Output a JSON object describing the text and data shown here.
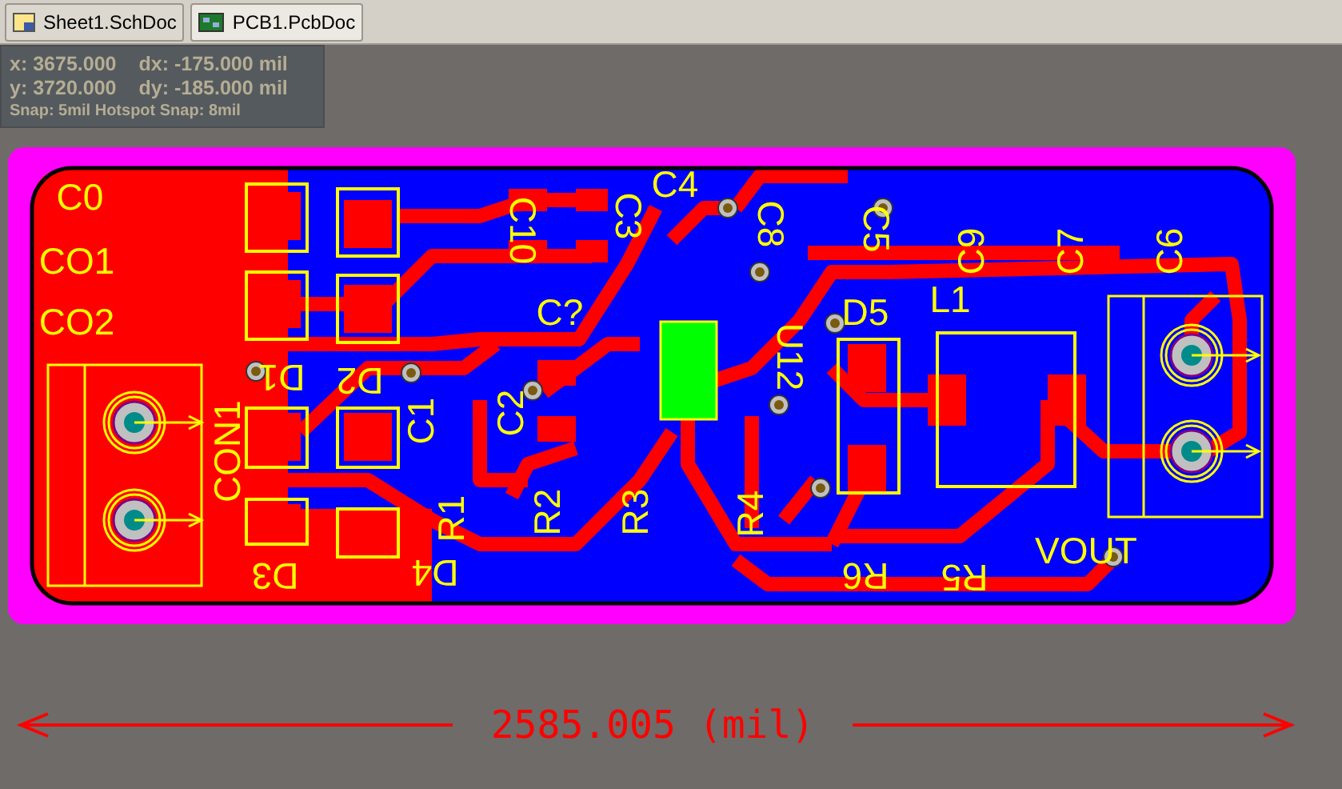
{
  "tabs": [
    {
      "label": "Sheet1.SchDoc",
      "kind": "schematic",
      "selected": false
    },
    {
      "label": "PCB1.PcbDoc",
      "kind": "pcb",
      "selected": true
    }
  ],
  "cursor_info": {
    "rows": [
      {
        "axis": "x:",
        "value": "3675.000",
        "delta_label": "dx:",
        "delta": "-175.000",
        "unit": "mil"
      },
      {
        "axis": "y:",
        "value": "3720.000",
        "delta_label": "dy:",
        "delta": "-185.000",
        "unit": "mil"
      }
    ],
    "snap": "Snap: 5mil Hotspot Snap: 8mil"
  },
  "designators": [
    "C0",
    "CO1",
    "CO2",
    "CON1",
    "D1",
    "D2",
    "C1",
    "C2",
    "C?",
    "C10",
    "C3",
    "C4",
    "C8",
    "C5",
    "C9",
    "C7",
    "C6",
    "U12",
    "D5",
    "L1",
    "R1",
    "R2",
    "R3",
    "R4",
    "D3",
    "D4",
    "R6",
    "R5",
    "VOUT"
  ],
  "dimension": {
    "text": "2585.005 (mil)"
  }
}
